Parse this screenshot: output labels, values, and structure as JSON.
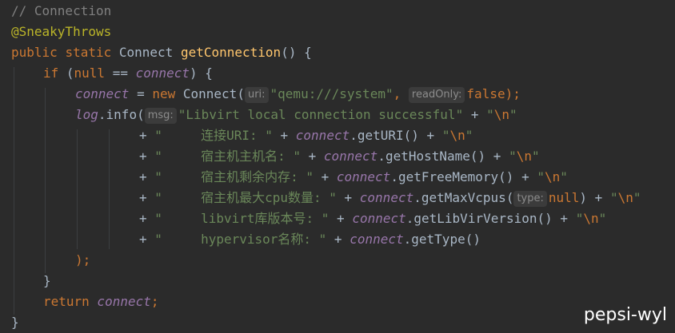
{
  "editor": {
    "comment": "// Connection",
    "annotation": "@SneakyThrows",
    "sig": {
      "kw1": "public",
      "kw2": "static",
      "type": "Connect",
      "method": "getConnection",
      "rest": "() {"
    },
    "if_line": {
      "kw": "if",
      "open": " (",
      "null": "null",
      "op": " == ",
      "var": "connect",
      "close": ") {"
    },
    "assign": {
      "var": "connect",
      "eq": " = ",
      "new": "new",
      "cls": " Connect(",
      "hint1": "uri:",
      "str1": "\"qemu:///system\"",
      "comma": ", ",
      "hint2": "readOnly:",
      "false": "false",
      "end": ");"
    },
    "log": {
      "obj": "log",
      "call": ".info(",
      "hint": "msg:",
      "str": "\"Libvirt local connection successful\"",
      "plus": " + ",
      "nl_open": "\"",
      "nl_esc": "\\n",
      "nl_close": "\""
    },
    "concat": [
      {
        "lead": "+ ",
        "str": "\"     连接URI: \"",
        "mid": " + ",
        "var": "connect",
        "call": ".getURI()",
        "hint": "",
        "arg": "",
        "tail": " + ",
        "nl": true
      },
      {
        "lead": "+ ",
        "str": "\"     宿主机主机名: \"",
        "mid": " + ",
        "var": "connect",
        "call": ".getHostName()",
        "hint": "",
        "arg": "",
        "tail": " + ",
        "nl": true
      },
      {
        "lead": "+ ",
        "str": "\"     宿主机剩余内存: \"",
        "mid": " + ",
        "var": "connect",
        "call": ".getFreeMemory()",
        "hint": "",
        "arg": "",
        "tail": " + ",
        "nl": true
      },
      {
        "lead": "+ ",
        "str": "\"     宿主机最大cpu数量: \"",
        "mid": " + ",
        "var": "connect",
        "call": ".getMaxVcpus(",
        "hint": "type:",
        "arg": "null",
        "close": ")",
        "tail": " + ",
        "nl": true
      },
      {
        "lead": "+ ",
        "str": "\"     libvirt库版本号: \"",
        "mid": " + ",
        "var": "connect",
        "call": ".getLibVirVersion()",
        "hint": "",
        "arg": "",
        "tail": " + ",
        "nl": true
      },
      {
        "lead": "+ ",
        "str": "\"     hypervisor名称: \"",
        "mid": " + ",
        "var": "connect",
        "call": ".getType()",
        "hint": "",
        "arg": "",
        "tail": "",
        "nl": false
      }
    ],
    "close_paren": ");",
    "close_if": "}",
    "ret": {
      "kw": "return",
      "var": " connect",
      "semi": ";"
    },
    "close_method": "}"
  },
  "watermark": "pepsi-wyl",
  "colors": {
    "background": "#2b2b2b",
    "keyword": "#cc7832",
    "annotation": "#bbb529",
    "method": "#ffc66d",
    "field": "#9876aa",
    "string": "#6a8759",
    "comment": "#808080",
    "text": "#a9b7c6"
  }
}
